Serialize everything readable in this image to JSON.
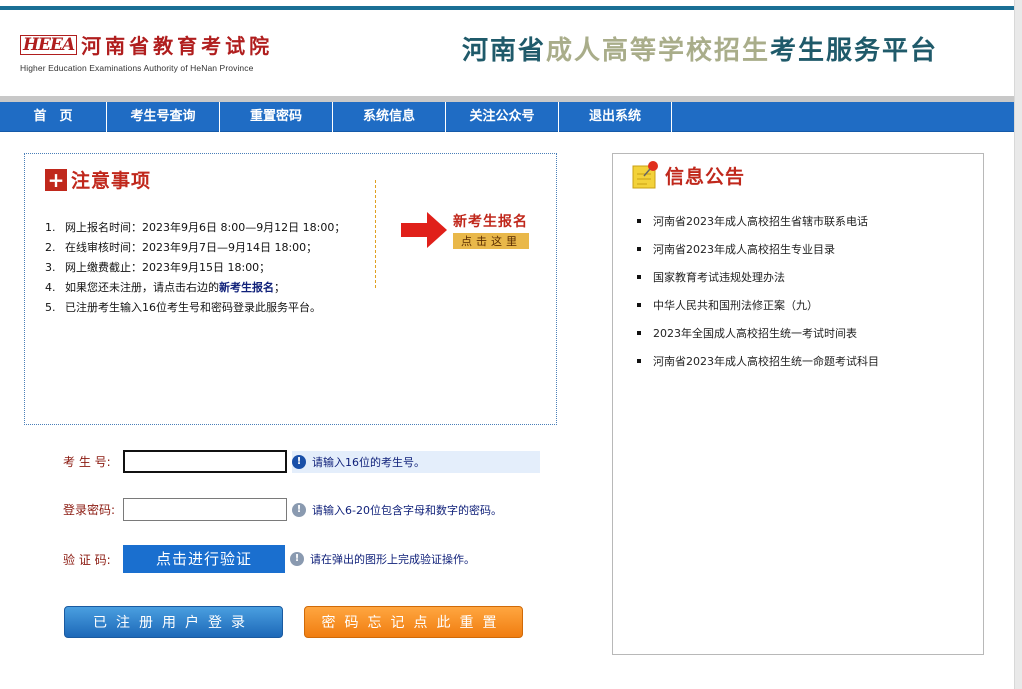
{
  "header": {
    "logo_mark": "HEEA",
    "logo_cn": "河南省教育考试院",
    "logo_en": "Higher Education Examinations Authority of HeNan Province",
    "title_part1": "河南省",
    "title_part2": "成人高等学校招生",
    "title_part3": "考生服务平台"
  },
  "nav": {
    "items": [
      {
        "label": "首　页"
      },
      {
        "label": "考生号查询"
      },
      {
        "label": "重置密码"
      },
      {
        "label": "系统信息"
      },
      {
        "label": "关注公众号"
      },
      {
        "label": "退出系统"
      }
    ]
  },
  "notice": {
    "title": "注意事项",
    "items": [
      {
        "num": "1.",
        "text": "网上报名时间：2023年9月6日 8:00—9月12日 18:00；"
      },
      {
        "num": "2.",
        "text": "在线审核时间：2023年9月7日—9月14日 18:00；"
      },
      {
        "num": "3.",
        "text": "网上缴费截止：2023年9月15日 18:00；"
      },
      {
        "num": "4.",
        "text_before": "如果您还未注册，请点击右边的",
        "text_strong": "新考生报名",
        "text_after": "；"
      },
      {
        "num": "5.",
        "text": "已注册考生输入16位考生号和密码登录此服务平台。"
      }
    ],
    "register_big": "新考生报名",
    "register_small": "点击这里"
  },
  "form": {
    "exam_label": "考 生 号:",
    "exam_value": "",
    "exam_hint": "请输入16位的考生号。",
    "password_label": "登录密码:",
    "password_value": "",
    "password_hint": "请输入6-20位包含字母和数字的密码。",
    "verify_label": "验 证 码:",
    "verify_button": "点击进行验证",
    "verify_hint": "请在弹出的图形上完成验证操作。"
  },
  "buttons": {
    "login": "已注册用户登录",
    "reset": "密码忘记点此重置"
  },
  "info": {
    "title": "信息公告",
    "items": [
      {
        "text": "河南省2023年成人高校招生省辖市联系电话"
      },
      {
        "text": "河南省2023年成人高校招生专业目录"
      },
      {
        "text": "国家教育考试违规处理办法"
      },
      {
        "text": "中华人民共和国刑法修正案（九）"
      },
      {
        "text": "2023年全国成人高校招生统一考试时间表"
      },
      {
        "text": "河南省2023年成人高校招生统一命题考试科目"
      }
    ]
  },
  "colors": {
    "nav_blue": "#1f6cc4",
    "accent_red": "#c0281c",
    "title_teal": "#1f5a6a",
    "title_olive": "#a9ad8a",
    "login_blue": "#1d68b8",
    "reset_orange": "#f07d10"
  },
  "icons": {
    "notice": "plus-box-icon",
    "register": "arrow-right-icon",
    "info": "memo-pin-icon",
    "hint_active": "info-circle-icon",
    "hint_idle": "info-circle-gray-icon"
  }
}
